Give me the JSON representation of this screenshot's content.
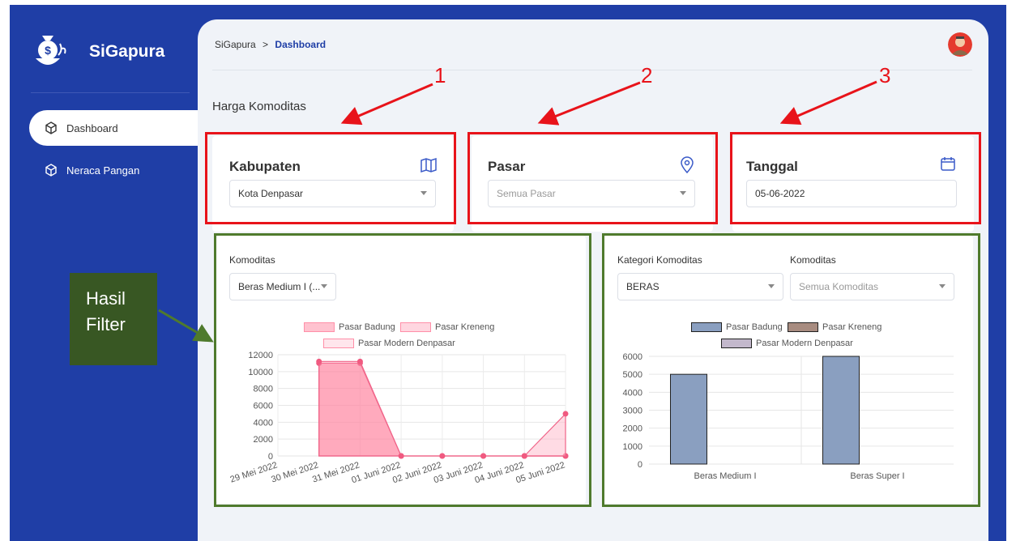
{
  "app": {
    "name": "SiGapura"
  },
  "sidebar": {
    "items": [
      {
        "label": "Dashboard",
        "icon": "cube-icon",
        "active": true
      },
      {
        "label": "Neraca Pangan",
        "icon": "cube-icon",
        "active": false
      }
    ]
  },
  "breadcrumb": {
    "root": "SiGapura",
    "separator": ">",
    "current": "Dashboard"
  },
  "page": {
    "title": "Harga Komoditas"
  },
  "filters": {
    "kabupaten": {
      "label": "Kabupaten",
      "value": "Kota Denpasar",
      "icon": "map-icon"
    },
    "pasar": {
      "label": "Pasar",
      "placeholder": "Semua Pasar",
      "icon": "location-pin-icon"
    },
    "tanggal": {
      "label": "Tanggal",
      "value": "05-06-2022",
      "icon": "calendar-icon"
    }
  },
  "annotations": {
    "numbers": [
      "1",
      "2",
      "3"
    ],
    "result_label_line1": "Hasil",
    "result_label_line2": "Filter",
    "colors": {
      "red": "#e8131a",
      "green": "#4f7a2d",
      "label_bg": "#385723"
    }
  },
  "left_panel": {
    "komoditas_label": "Komoditas",
    "komoditas_value": "Beras Medium I (..."
  },
  "right_panel": {
    "kategori_label": "Kategori Komoditas",
    "kategori_value": "BERAS",
    "komoditas_label": "Komoditas",
    "komoditas_placeholder": "Semua Komoditas"
  },
  "colors": {
    "primary": "#1f3ea6",
    "main_bg": "#f0f3f8"
  },
  "chart_data": [
    {
      "type": "area",
      "x": [
        "29 Mei 2022",
        "30 Mei 2022",
        "31 Mei 2022",
        "01 Juni 2022",
        "02 Juni 2022",
        "03 Juni 2022",
        "04 Juni 2022",
        "05 Juni 2022"
      ],
      "ylim": [
        0,
        12000
      ],
      "yticks": [
        "0",
        "2000",
        "4000",
        "6000",
        "8000",
        "10000",
        "12000"
      ],
      "legend": [
        "Pasar Badung",
        "Pasar Kreneng",
        "Pasar Modern Denpasar"
      ],
      "legend_position": "top",
      "grid": true,
      "series": [
        {
          "name": "Pasar Badung",
          "values": [
            null,
            11000,
            11000,
            0,
            0,
            0,
            0,
            0
          ],
          "color": "#ff8fa8"
        },
        {
          "name": "Pasar Kreneng",
          "values": [
            null,
            11200,
            11200,
            0,
            0,
            0,
            0,
            0
          ],
          "color": "#ffb3c3"
        },
        {
          "name": "Pasar Modern Denpasar",
          "values": [
            null,
            null,
            null,
            null,
            null,
            null,
            0,
            5000
          ],
          "color": "#ffd6e0"
        }
      ]
    },
    {
      "type": "bar",
      "categories": [
        "Beras Medium I",
        "Beras Super I"
      ],
      "ylim": [
        0,
        6000
      ],
      "yticks": [
        "0",
        "1000",
        "2000",
        "3000",
        "4000",
        "5000",
        "6000"
      ],
      "legend": [
        "Pasar Badung",
        "Pasar Kreneng",
        "Pasar Modern Denpasar"
      ],
      "legend_position": "top",
      "grid": true,
      "series": [
        {
          "name": "Pasar Badung",
          "values": [
            5000,
            6000
          ],
          "color": "#8a9fc0"
        },
        {
          "name": "Pasar Kreneng",
          "values": [
            0,
            0
          ],
          "color": "#a88c80"
        },
        {
          "name": "Pasar Modern Denpasar",
          "values": [
            0,
            0
          ],
          "color": "#c3b8cc"
        }
      ]
    }
  ]
}
